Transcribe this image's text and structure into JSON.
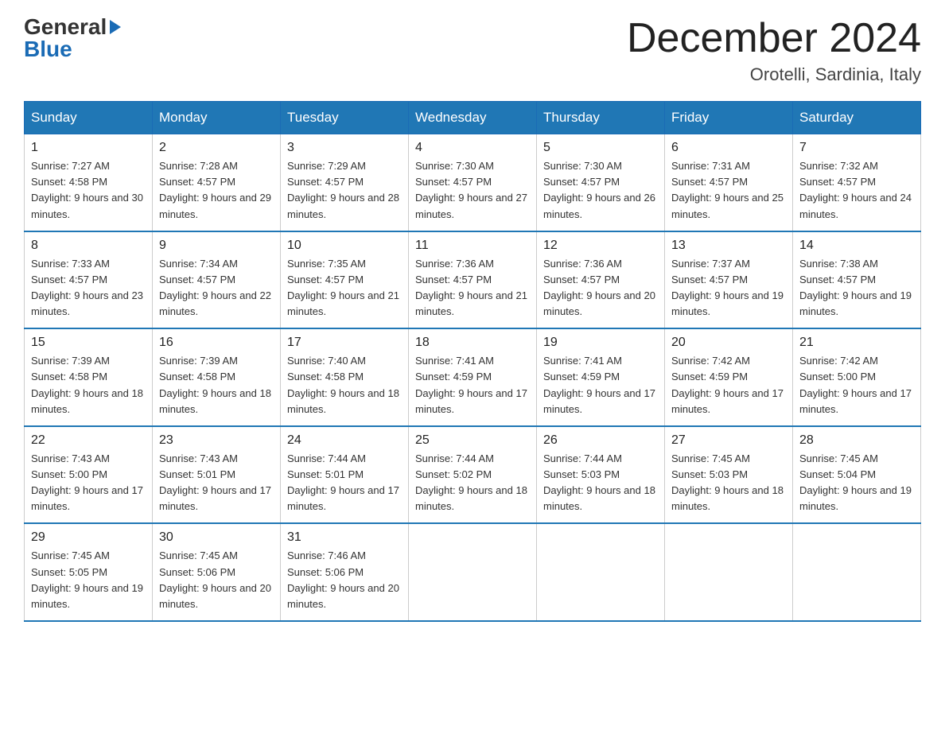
{
  "logo": {
    "general": "General",
    "blue": "Blue"
  },
  "title": "December 2024",
  "subtitle": "Orotelli, Sardinia, Italy",
  "weekdays": [
    "Sunday",
    "Monday",
    "Tuesday",
    "Wednesday",
    "Thursday",
    "Friday",
    "Saturday"
  ],
  "weeks": [
    [
      {
        "day": "1",
        "sunrise": "7:27 AM",
        "sunset": "4:58 PM",
        "daylight": "9 hours and 30 minutes."
      },
      {
        "day": "2",
        "sunrise": "7:28 AM",
        "sunset": "4:57 PM",
        "daylight": "9 hours and 29 minutes."
      },
      {
        "day": "3",
        "sunrise": "7:29 AM",
        "sunset": "4:57 PM",
        "daylight": "9 hours and 28 minutes."
      },
      {
        "day": "4",
        "sunrise": "7:30 AM",
        "sunset": "4:57 PM",
        "daylight": "9 hours and 27 minutes."
      },
      {
        "day": "5",
        "sunrise": "7:30 AM",
        "sunset": "4:57 PM",
        "daylight": "9 hours and 26 minutes."
      },
      {
        "day": "6",
        "sunrise": "7:31 AM",
        "sunset": "4:57 PM",
        "daylight": "9 hours and 25 minutes."
      },
      {
        "day": "7",
        "sunrise": "7:32 AM",
        "sunset": "4:57 PM",
        "daylight": "9 hours and 24 minutes."
      }
    ],
    [
      {
        "day": "8",
        "sunrise": "7:33 AM",
        "sunset": "4:57 PM",
        "daylight": "9 hours and 23 minutes."
      },
      {
        "day": "9",
        "sunrise": "7:34 AM",
        "sunset": "4:57 PM",
        "daylight": "9 hours and 22 minutes."
      },
      {
        "day": "10",
        "sunrise": "7:35 AM",
        "sunset": "4:57 PM",
        "daylight": "9 hours and 21 minutes."
      },
      {
        "day": "11",
        "sunrise": "7:36 AM",
        "sunset": "4:57 PM",
        "daylight": "9 hours and 21 minutes."
      },
      {
        "day": "12",
        "sunrise": "7:36 AM",
        "sunset": "4:57 PM",
        "daylight": "9 hours and 20 minutes."
      },
      {
        "day": "13",
        "sunrise": "7:37 AM",
        "sunset": "4:57 PM",
        "daylight": "9 hours and 19 minutes."
      },
      {
        "day": "14",
        "sunrise": "7:38 AM",
        "sunset": "4:57 PM",
        "daylight": "9 hours and 19 minutes."
      }
    ],
    [
      {
        "day": "15",
        "sunrise": "7:39 AM",
        "sunset": "4:58 PM",
        "daylight": "9 hours and 18 minutes."
      },
      {
        "day": "16",
        "sunrise": "7:39 AM",
        "sunset": "4:58 PM",
        "daylight": "9 hours and 18 minutes."
      },
      {
        "day": "17",
        "sunrise": "7:40 AM",
        "sunset": "4:58 PM",
        "daylight": "9 hours and 18 minutes."
      },
      {
        "day": "18",
        "sunrise": "7:41 AM",
        "sunset": "4:59 PM",
        "daylight": "9 hours and 17 minutes."
      },
      {
        "day": "19",
        "sunrise": "7:41 AM",
        "sunset": "4:59 PM",
        "daylight": "9 hours and 17 minutes."
      },
      {
        "day": "20",
        "sunrise": "7:42 AM",
        "sunset": "4:59 PM",
        "daylight": "9 hours and 17 minutes."
      },
      {
        "day": "21",
        "sunrise": "7:42 AM",
        "sunset": "5:00 PM",
        "daylight": "9 hours and 17 minutes."
      }
    ],
    [
      {
        "day": "22",
        "sunrise": "7:43 AM",
        "sunset": "5:00 PM",
        "daylight": "9 hours and 17 minutes."
      },
      {
        "day": "23",
        "sunrise": "7:43 AM",
        "sunset": "5:01 PM",
        "daylight": "9 hours and 17 minutes."
      },
      {
        "day": "24",
        "sunrise": "7:44 AM",
        "sunset": "5:01 PM",
        "daylight": "9 hours and 17 minutes."
      },
      {
        "day": "25",
        "sunrise": "7:44 AM",
        "sunset": "5:02 PM",
        "daylight": "9 hours and 18 minutes."
      },
      {
        "day": "26",
        "sunrise": "7:44 AM",
        "sunset": "5:03 PM",
        "daylight": "9 hours and 18 minutes."
      },
      {
        "day": "27",
        "sunrise": "7:45 AM",
        "sunset": "5:03 PM",
        "daylight": "9 hours and 18 minutes."
      },
      {
        "day": "28",
        "sunrise": "7:45 AM",
        "sunset": "5:04 PM",
        "daylight": "9 hours and 19 minutes."
      }
    ],
    [
      {
        "day": "29",
        "sunrise": "7:45 AM",
        "sunset": "5:05 PM",
        "daylight": "9 hours and 19 minutes."
      },
      {
        "day": "30",
        "sunrise": "7:45 AM",
        "sunset": "5:06 PM",
        "daylight": "9 hours and 20 minutes."
      },
      {
        "day": "31",
        "sunrise": "7:46 AM",
        "sunset": "5:06 PM",
        "daylight": "9 hours and 20 minutes."
      },
      null,
      null,
      null,
      null
    ]
  ]
}
